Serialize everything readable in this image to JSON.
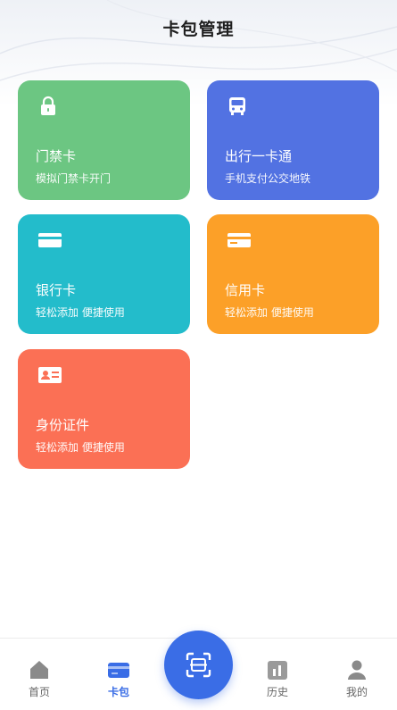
{
  "header": {
    "title": "卡包管理"
  },
  "cards": [
    {
      "id": "door",
      "icon": "lock-icon",
      "name": "门禁卡",
      "desc": "模拟门禁卡开门",
      "color": "#6cc682"
    },
    {
      "id": "transit",
      "icon": "bus-icon",
      "name": "出行一卡通",
      "desc": "手机支付公交地铁",
      "color": "#5272e2"
    },
    {
      "id": "bank",
      "icon": "bank-card-icon",
      "name": "银行卡",
      "desc": "轻松添加 便捷使用",
      "color": "#23bccb"
    },
    {
      "id": "credit",
      "icon": "credit-card-icon",
      "name": "信用卡",
      "desc": "轻松添加 便捷使用",
      "color": "#fca028"
    },
    {
      "id": "idcard",
      "icon": "id-card-icon",
      "name": "身份证件",
      "desc": "轻松添加 便捷使用",
      "color": "#fb7055"
    }
  ],
  "tabbar": {
    "home": "首页",
    "card": "卡包",
    "history": "历史",
    "mine": "我的",
    "scan_icon": "scan-icon",
    "active": "card",
    "accent": "#3a6de6"
  }
}
